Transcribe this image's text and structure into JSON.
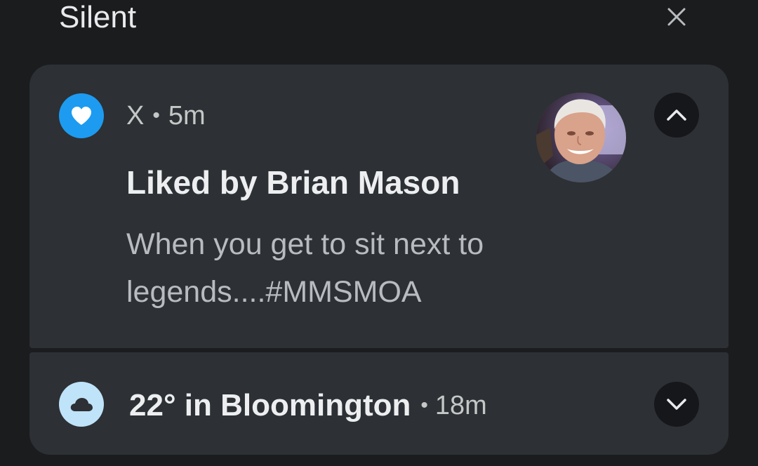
{
  "section": {
    "title": "Silent",
    "dismiss_icon": "close-icon"
  },
  "notifications": [
    {
      "app_name": "X",
      "separator": "•",
      "time": "5m",
      "app_icon": "heart-icon",
      "app_icon_color": "#1d9bf0",
      "title": "Liked by Brian Mason",
      "body": "When you get to sit next to legends....#MMSMOA",
      "avatar": "profile-photo",
      "expand_state": "expanded",
      "chevron_icon": "chevron-up-icon"
    },
    {
      "app_icon": "cloud-icon",
      "app_icon_color": "#bfe3f9",
      "title": "22° in Bloomington",
      "separator": "•",
      "time": "18m",
      "expand_state": "collapsed",
      "chevron_icon": "chevron-down-icon"
    }
  ],
  "colors": {
    "background": "#1b1c1e",
    "card": "#2d3034",
    "title_text": "#eceef0",
    "secondary_text": "#c4c7c5"
  }
}
